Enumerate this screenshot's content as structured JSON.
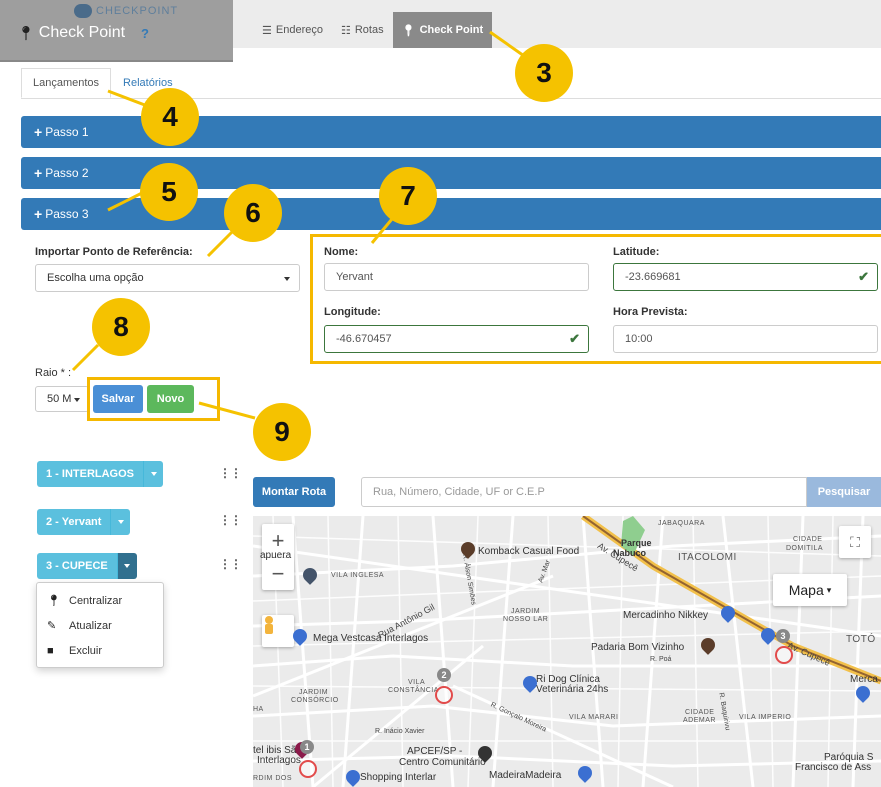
{
  "header": {
    "app_title": "Check Point",
    "help_mark": "?",
    "logo_text": "CHECKPOINT",
    "nav_tabs": [
      {
        "label": "Endereço",
        "icon": "list-icon"
      },
      {
        "label": "Rotas",
        "icon": "sitemap-icon"
      },
      {
        "label": "Check Point",
        "icon": "map-pin-icon",
        "active": true
      }
    ]
  },
  "subtabs": [
    {
      "label": "Lançamentos",
      "active": true
    },
    {
      "label": "Relatórios",
      "active": false
    }
  ],
  "panels": [
    {
      "label": "Passo 1"
    },
    {
      "label": "Passo 2"
    },
    {
      "label": "Passo 3"
    }
  ],
  "step3": {
    "import_label": "Importar Ponto de Referência:",
    "import_value": "Escolha uma opção",
    "nome_label": "Nome:",
    "nome_value": "Yervant",
    "latitude_label": "Latitude:",
    "latitude_value": "-23.669681",
    "longitude_label": "Longitude:",
    "longitude_value": "-46.670457",
    "hora_label": "Hora Prevista:",
    "hora_value": "10:00",
    "raio_label": "Raio * :",
    "raio_value": "50 M",
    "salvar_label": "Salvar",
    "novo_label": "Novo"
  },
  "callouts": [
    "3",
    "4",
    "5",
    "6",
    "7",
    "8",
    "9"
  ],
  "route_list": [
    {
      "label": "1 - INTERLAGOS"
    },
    {
      "label": "2 - Yervant"
    },
    {
      "label": "3 - CUPECE"
    }
  ],
  "route_menu": [
    {
      "label": "Centralizar",
      "icon": "map-pin-icon"
    },
    {
      "label": "Atualizar",
      "icon": "edit-icon"
    },
    {
      "label": "Excluir",
      "icon": "trash-icon"
    }
  ],
  "map_toolbar": {
    "montar_label": "Montar Rota",
    "search_placeholder": "Rua, Número, Cidade, UF or C.E.P",
    "search_button": "Pesquisar"
  },
  "map": {
    "type_label": "Mapa",
    "labels": {
      "jabaquara": "JABAQUARA",
      "parque": "Parque",
      "nabuco": "Nabuco",
      "itacolomi": "ITACOLOMI",
      "cidade_domitila_1": "CIDADE",
      "cidade_domitila_2": "DOMITILA",
      "apuera": "apuera",
      "vila_inglesa": "VILA INGLESA",
      "komback": "Komback Casual Food",
      "av_cupece_top": "Av. Cupecê",
      "jardim_nosso_lar_1": "JARDIM",
      "jardim_nosso_lar_2": "NOSSO LAR",
      "rua_antonio_gil": "Rua Antônio Gil",
      "mercadinho": "Mercadinho Nikkey",
      "mega": "Mega Vestcasa Interlagos",
      "padaria": "Padaria Bom Vizinho",
      "toto": "TOTÓ",
      "av_cupece_right": "Av. Cupecê",
      "merca": "Merca",
      "vila_constancia_1": "VILA",
      "vila_constancia_2": "CONSTÂNCIA",
      "jardim_consorcio_1": "JARDIM",
      "jardim_consorcio_2": "CONSÓRCIO",
      "ri_dog_1": "Ri Dog Clínica",
      "ri_dog_2": "Veterinária 24hs",
      "vila_marari": "VILA MARARI",
      "cidade_ademar_1": "CIDADE",
      "cidade_ademar_2": "ADEMAR",
      "vila_imperio": "VILA IMPERIO",
      "r_inacio": "R. Inácio Xavier",
      "r_goncalo": "R. Gonçalo Moreira",
      "ibis_1": "tel ibis Sã",
      "ibis_2": "Interlagos",
      "apcef_1": "APCEF/SP -",
      "apcef_2": "Centro Comunitário",
      "shopping": "Shopping Interlar",
      "madeira": "MadeiraMadeira",
      "paroquia_1": "Paróquia S",
      "paroquia_2": "Francisco de Ass",
      "rdim": "RDIM DOS",
      "ha": "HA",
      "r_alson": "R. Álson Simões",
      "av_mar": "Av. Mar",
      "r_baquirivu": "R. Baquirivu",
      "r_poa": "R. Poá"
    },
    "markers": [
      "1",
      "2",
      "3"
    ]
  },
  "colors": {
    "primary": "#337ab7",
    "info": "#5bc0de",
    "success": "#5cb85c",
    "callout": "#f5c200"
  }
}
